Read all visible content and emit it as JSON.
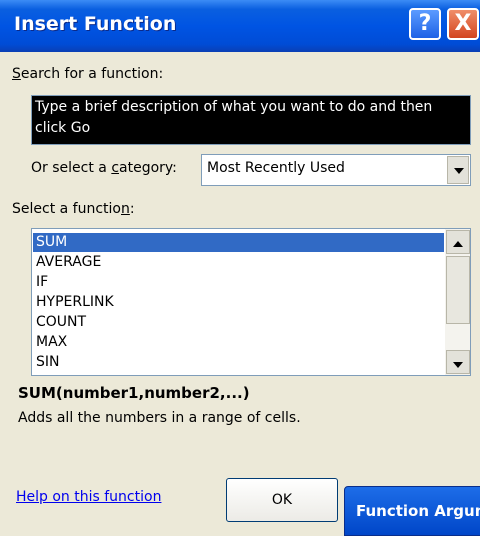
{
  "window": {
    "title": "Insert Function",
    "help_symbol": "?",
    "close_symbol": "X"
  },
  "search": {
    "label": "Search for a function:",
    "underline_char": "S",
    "label_rest": "earch for a function:",
    "text": "Type a brief description of what you want to do and then click Go"
  },
  "category": {
    "label_pre": "Or select a ",
    "underline_char": "c",
    "label_post": "ategory:",
    "selected": "Most Recently Used"
  },
  "functions": {
    "label_pre": "Select a functio",
    "underline_char": "n",
    "label_post": ":",
    "items": [
      "SUM",
      "AVERAGE",
      "IF",
      "HYPERLINK",
      "COUNT",
      "MAX",
      "SIN"
    ],
    "selected": "SUM"
  },
  "details": {
    "syntax": "SUM(number1,number2,...)",
    "description": "Adds all the numbers in a range of cells."
  },
  "footer": {
    "help_link": "Help on this function",
    "ok_label": "OK",
    "function_arguments_label": "Function Argum"
  },
  "icons": {
    "dropdown": "chevron-down-icon",
    "scroll_up": "arrow-up-icon",
    "scroll_down": "arrow-down-icon"
  },
  "colors": {
    "title_bar": "#0054E3",
    "selection": "#316AC5",
    "dialog_bg": "#ECE9D8",
    "link": "#0000EE"
  }
}
